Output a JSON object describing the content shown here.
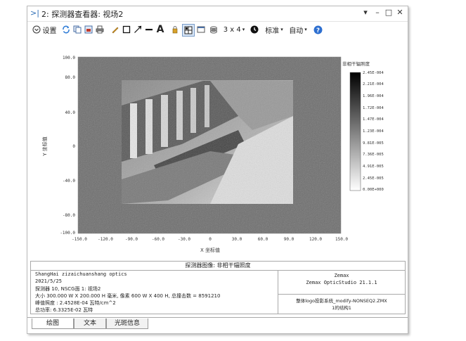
{
  "window": {
    "title": "2: 探测器查看器: 视场2",
    "controls": {
      "dropdown": "▾",
      "minimize": "–",
      "maximize": "□",
      "close": "✕"
    }
  },
  "toolbar": {
    "settings_label": "设置",
    "layout_label": "3 x 4",
    "layout_arrow": "▾",
    "standard_label": "标准",
    "standard_arrow": "▾",
    "auto_label": "自动",
    "auto_arrow": "▾",
    "icons": [
      "chevron-circle-icon",
      "refresh-icon",
      "copy-icon",
      "export-icon",
      "print-icon",
      "pencil-icon",
      "rectangle-icon",
      "arrow-icon",
      "line-icon",
      "text-icon",
      "lock-icon",
      "grid-icon",
      "window-icon",
      "layers-icon",
      "timer-icon",
      "help-icon"
    ]
  },
  "plot": {
    "y_ticks": [
      "100.0",
      "80.0",
      "40.0",
      "0",
      "-40.0",
      "-80.0",
      "-100.0"
    ],
    "x_ticks": [
      "-150.0",
      "-120.0",
      "-90.0",
      "-60.0",
      "-30.0",
      "0",
      "30.0",
      "60.0",
      "90.0",
      "120.0",
      "150.0"
    ],
    "x_label": "X 坐标值",
    "y_label": "Y 坐标值",
    "colorbar_title": "非相干辐照度",
    "colorbar_ticks": [
      "2.45E-004",
      "2.21E-004",
      "1.96E-004",
      "1.72E-004",
      "1.47E-004",
      "1.23E-004",
      "9.81E-005",
      "7.36E-005",
      "4.91E-005",
      "2.45E-005",
      "0.00E+000"
    ]
  },
  "caption": "探测器图像: 非相干辐照度",
  "info_left": {
    "line1": "ShangHai zizaichuanshang optics",
    "line2": "2021/5/25",
    "line3": "探测器 10, NSCG面 1: 视场2",
    "line4": "大小 300.000 W X 200.000 H 毫米, 像素 600 W X 400 H, 总撞击数 = 8591210",
    "line5": "峰值照度 : 2.4528E-04 瓦特/cm^2",
    "line6": "总功率: 6.3325E-02 瓦特"
  },
  "info_right": {
    "brand": "Zemax",
    "product": "Zemax OpticStudio 21.1.1",
    "file_line1": "整体logo投影系统_modify-NONSEQ2.ZMX",
    "file_line2": "1的结构1"
  },
  "tabs": [
    {
      "label": "绘图"
    },
    {
      "label": "文本"
    },
    {
      "label": "光斑信息"
    }
  ]
}
